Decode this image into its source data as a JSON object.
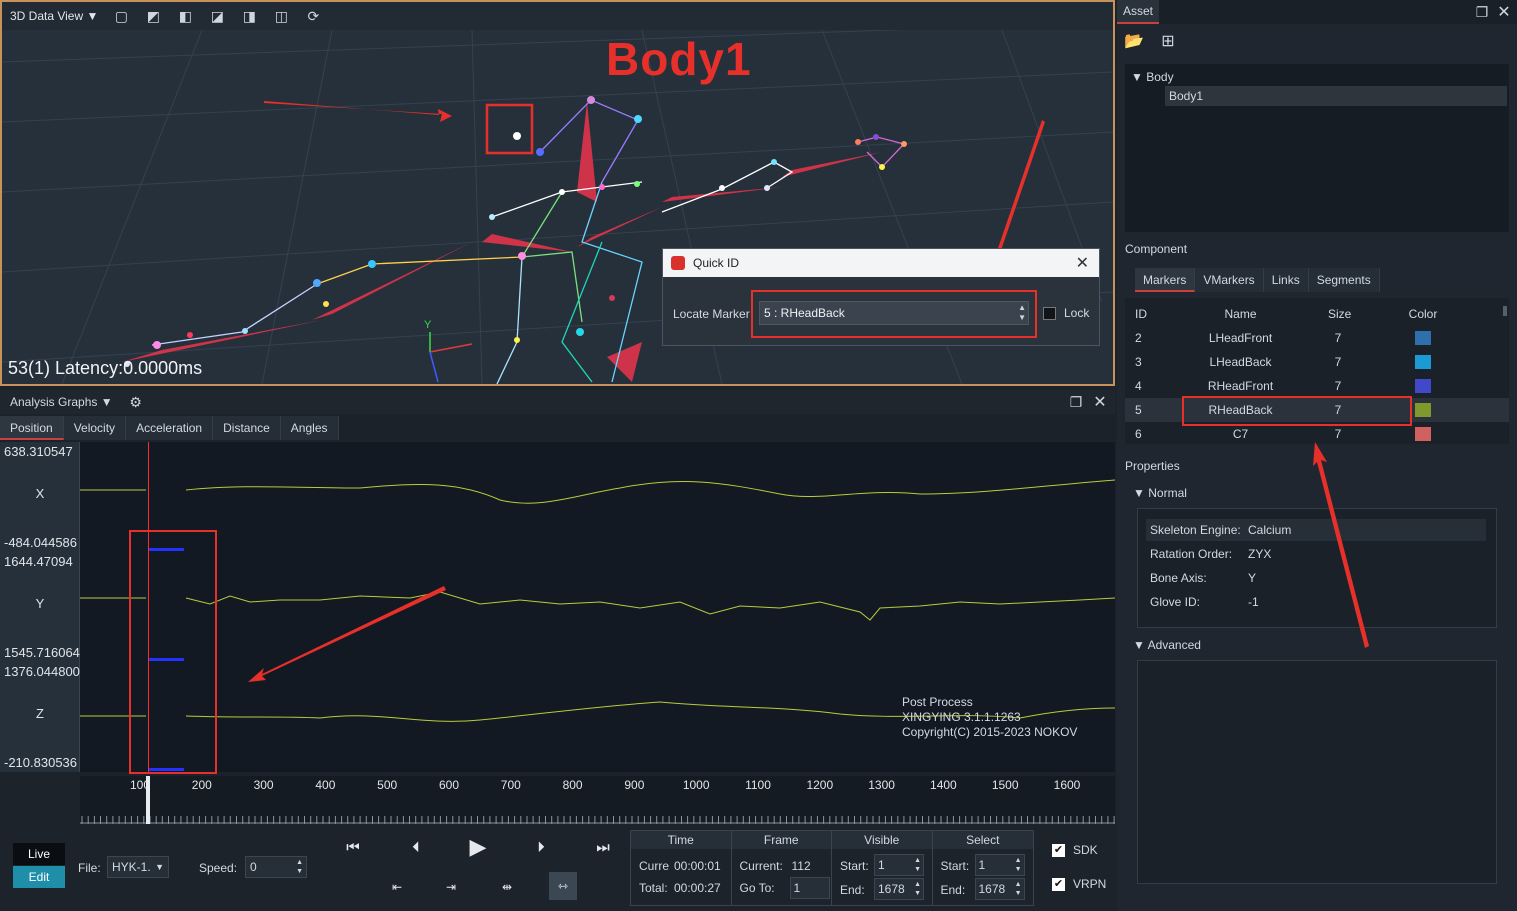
{
  "view3d": {
    "title": "3D Data View",
    "body_label": "Body1",
    "status": "53(1) Latency:0.0000ms",
    "axis_y": "Y",
    "quickid": {
      "title": "Quick ID",
      "locate_label": "Locate Marker",
      "locate_value": "5 : RHeadBack",
      "lock_label": "Lock"
    }
  },
  "graphs": {
    "title": "Analysis Graphs",
    "tabs": [
      "Position",
      "Velocity",
      "Acceleration",
      "Distance",
      "Angles"
    ],
    "lanes": [
      {
        "axis": "X",
        "top": "638.310547",
        "bottom": "-484.044586"
      },
      {
        "axis": "Y",
        "top": "1644.47094",
        "bottom": "1545.716064"
      },
      {
        "axis": "Z",
        "top": "1376.044800",
        "bottom": "-210.830536"
      }
    ],
    "watermark": [
      "Post Process",
      "XINGYING 3.1.1.1263",
      "Copyright(C) 2015-2023 NOKOV"
    ],
    "ruler_ticks": [
      "100",
      "200",
      "300",
      "400",
      "500",
      "600",
      "700",
      "800",
      "900",
      "1000",
      "1100",
      "1200",
      "1300",
      "1400",
      "1500",
      "1600"
    ]
  },
  "controls": {
    "live": "Live",
    "edit": "Edit",
    "file_label": "File:",
    "file_value": "HYK-1.",
    "speed_label": "Speed:",
    "speed_value": "0",
    "time": {
      "header": "Time",
      "current_label": "Curre",
      "current_value": "00:00:01",
      "total_label": "Total:",
      "total_value": "00:00:27"
    },
    "frame": {
      "header": "Frame",
      "current_label": "Current:",
      "current_value": "112",
      "goto_label": "Go To:",
      "goto_value": "1"
    },
    "visible": {
      "header": "Visible",
      "start_label": "Start:",
      "start_value": "1",
      "end_label": "End:",
      "end_value": "1678"
    },
    "select": {
      "header": "Select",
      "start_label": "Start:",
      "start_value": "1",
      "end_label": "End:",
      "end_value": "1678"
    },
    "sdk": "SDK",
    "vrpn": "VRPN"
  },
  "asset": {
    "title": "Asset",
    "tree_root": "Body",
    "tree_child": "Body1"
  },
  "component": {
    "title": "Component",
    "tabs": [
      "Markers",
      "VMarkers",
      "Links",
      "Segments"
    ],
    "headers": [
      "ID",
      "Name",
      "Size",
      "Color"
    ],
    "rows": [
      {
        "id": "2",
        "name": "LHeadFront",
        "size": "7",
        "color": "#2e6fb0"
      },
      {
        "id": "3",
        "name": "LHeadBack",
        "size": "7",
        "color": "#1b9ad6"
      },
      {
        "id": "4",
        "name": "RHeadFront",
        "size": "7",
        "color": "#3f49c9"
      },
      {
        "id": "5",
        "name": "RHeadBack",
        "size": "7",
        "color": "#7e9a2d"
      },
      {
        "id": "6",
        "name": "C7",
        "size": "7",
        "color": "#d0615f"
      }
    ]
  },
  "properties": {
    "title": "Properties",
    "normal_label": "Normal",
    "advanced_label": "Advanced",
    "items": [
      {
        "label": "Skeleton Engine:",
        "value": "Calcium"
      },
      {
        "label": "Ratation Order:",
        "value": "ZYX"
      },
      {
        "label": "Bone Axis:",
        "value": "Y"
      },
      {
        "label": "Glove ID:",
        "value": "-1"
      }
    ]
  }
}
